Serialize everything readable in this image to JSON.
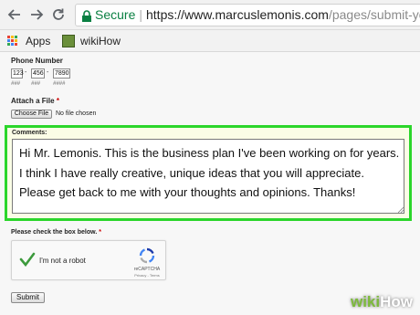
{
  "browser": {
    "secure_label": "Secure",
    "url_host": "https://www.marcuslemonis.com",
    "url_path": "/pages/submit-your-bu",
    "security_color": "#0b8043"
  },
  "bookmarks": {
    "items": [
      {
        "label": "Apps",
        "icon": "apps-grid-icon"
      },
      {
        "label": "wikiHow",
        "icon": "wikihow-favicon"
      }
    ]
  },
  "form": {
    "phone": {
      "label": "Phone Number",
      "area": "123",
      "prefix": "456",
      "line": "7890",
      "separator": "-",
      "hint_area": "###",
      "hint_prefix": "###",
      "hint_line": "####"
    },
    "attach": {
      "label": "Attach a File",
      "required_mark": "*",
      "button_label": "Choose File",
      "status": "No file chosen"
    },
    "comments": {
      "label": "Comments:",
      "value": "Hi Mr. Lemonis. This is the business plan I've been working on for years. I think I have really creative, unique ideas that you will appreciate. Please get back to me with your thoughts and opinions. Thanks!",
      "highlight_color": "#2bd62b"
    },
    "captcha": {
      "label": "Please check the box below.",
      "required_mark": "*",
      "checkbox_label": "I'm not a robot",
      "checked": true,
      "brand": "reCAPTCHA",
      "terms": "Privacy - Terms"
    },
    "submit_label": "Submit"
  },
  "watermark": {
    "wiki": "wiki",
    "how": "How"
  }
}
